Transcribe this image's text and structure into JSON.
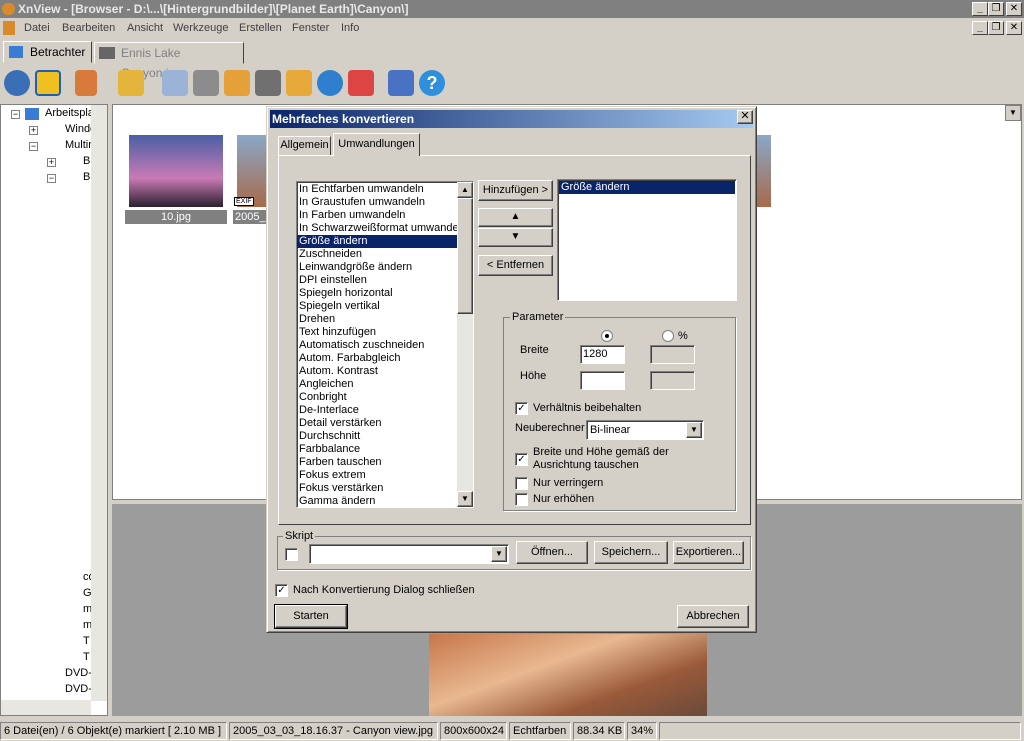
{
  "window": {
    "title": "XnView - [Browser - D:\\...\\[Hintergrundbilder]\\[Planet Earth]\\Canyon\\]"
  },
  "menu": [
    "Datei",
    "Bearbeiten",
    "Ansicht",
    "Werkzeuge",
    "Erstellen",
    "Fenster",
    "Info"
  ],
  "tabs": {
    "viewer": "Betrachter",
    "image": "Ennis Lake Canyon.jpg"
  },
  "tree": {
    "root": "Arbeitspla",
    "items": [
      "Winde",
      "Multin",
      "B",
      "B",
      "co",
      "G",
      "m",
      "m",
      "T",
      "T",
      "DVD-R",
      "DVD-R"
    ]
  },
  "thumbnails": [
    {
      "label": "10.jpg",
      "badge": ""
    },
    {
      "label": "2005_",
      "badge": "EXIF"
    }
  ],
  "dialog": {
    "title": "Mehrfaches konvertieren",
    "tabs": [
      "Allgemein",
      "Umwandlungen"
    ],
    "available": [
      "In Echtfarben umwandeln",
      "In Graustufen umwandeln",
      "In Farben umwandeln",
      "In Schwarzweißformat umwandeln",
      "Größe ändern",
      "Zuschneiden",
      "Leinwandgröße ändern",
      "DPI einstellen",
      "Spiegeln horizontal",
      "Spiegeln vertikal",
      "Drehen",
      "Text hinzufügen",
      "Automatisch zuschneiden",
      "Autom. Farbabgleich",
      "Autom. Kontrast",
      "Angleichen",
      "Conbright",
      "De-Interlace",
      "Detail verstärken",
      "Durchschnitt",
      "Farbbalance",
      "Farben tauschen",
      "Fokus extrem",
      "Fokus verstärken",
      "Gamma ändern"
    ],
    "selected_index": 4,
    "add": "Hinzufügen >",
    "remove": "< Entfernen",
    "applied": [
      "Größe ändern"
    ],
    "params": {
      "title": "Parameter",
      "pct": "%",
      "width_label": "Breite",
      "width_value": "1280",
      "height_label": "Höhe",
      "height_value": "",
      "keep_ratio": "Verhältnis beibehalten",
      "resample_label": "Neuberechner",
      "resample_value": "Bi-linear",
      "orient": "Breite und Höhe gemäß der",
      "orient2": "Ausrichtung tauschen",
      "shrink": "Nur verringern",
      "enlarge": "Nur erhöhen"
    },
    "script": {
      "title": "Skript",
      "value": "",
      "open": "Öffnen...",
      "save": "Speichern...",
      "export": "Exportieren..."
    },
    "close_after": "Nach Konvertierung Dialog schließen",
    "start": "Starten",
    "cancel": "Abbrechen"
  },
  "status": [
    "6 Datei(en) / 6 Objekt(e) markiert  [ 2.10 MB ]",
    "2005_03_03_18.16.37 - Canyon view.jpg",
    "800x600x24",
    "Echtfarben",
    "88.34 KB",
    "34%"
  ]
}
